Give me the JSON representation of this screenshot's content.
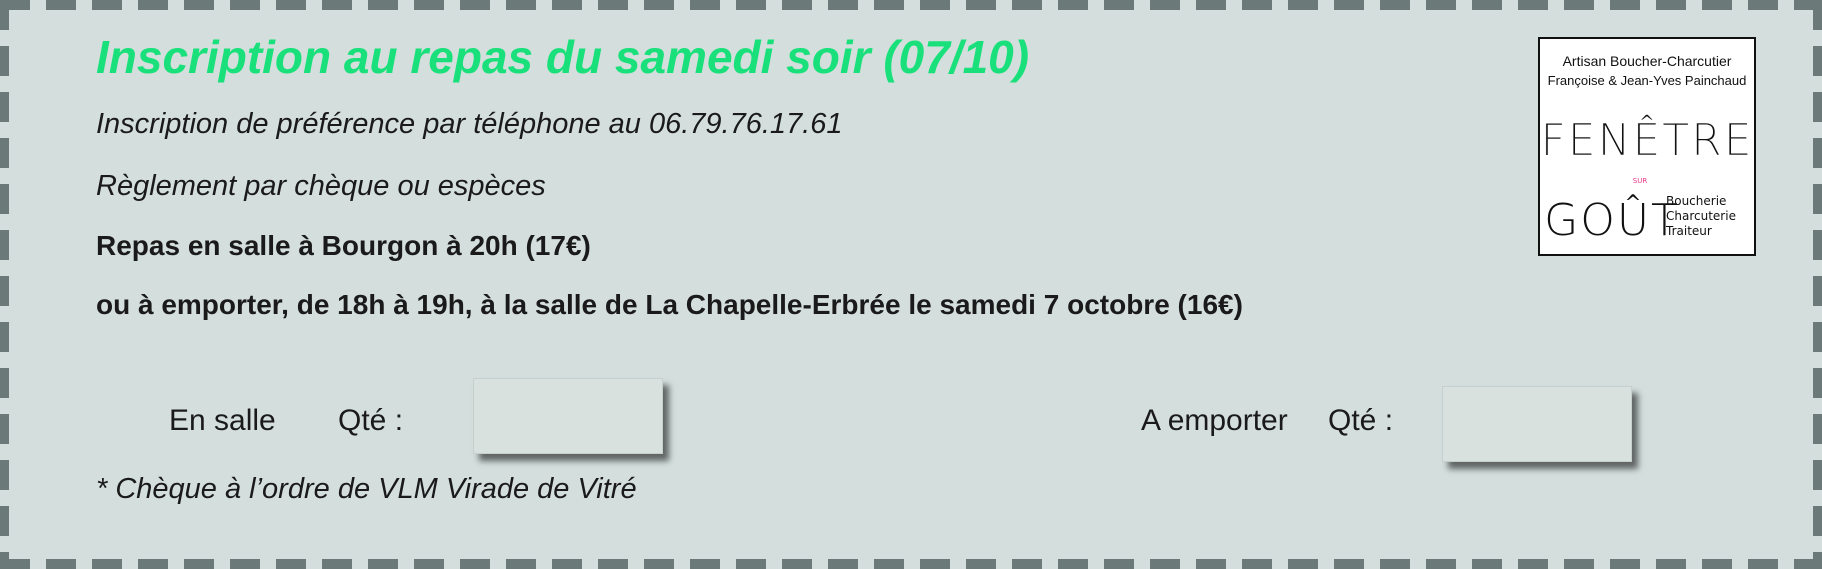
{
  "form": {
    "title": "Inscription au repas du samedi soir  (07/10)",
    "phone_line": "Inscription de préférence par téléphone au 06.79.76.17.61",
    "payment_line": "Règlement par chèque ou espèces",
    "dine_in_line": "Repas en salle à Bourgon à 20h (17€)",
    "takeaway_line": "ou à emporter, de 18h à 19h, à la salle de La Chapelle-Erbrée le samedi 7 octobre  (16€)",
    "dine_in_label": "En salle",
    "dine_in_qty_label": "Qté :",
    "takeaway_label": "A emporter",
    "takeaway_qty_label": "Qté :",
    "dine_in_qty_value": "",
    "takeaway_qty_value": "",
    "cheque_note": "* Chèque à l’ordre de VLM Virade de Vitré"
  },
  "logo": {
    "line1": "Artisan Boucher-Charcutier",
    "line2": "Françoise & Jean-Yves Painchaud",
    "word1": "FENÊTRE",
    "small": "SUR",
    "word2": "GOÛT",
    "tag1": "Boucherie",
    "tag2": "Charcuterie",
    "tag3": "Traiteur"
  },
  "colors": {
    "title": "#19e07a",
    "accent_pink": "#e8388a",
    "background": "#d4dfdd",
    "border": "#6b7a78"
  }
}
